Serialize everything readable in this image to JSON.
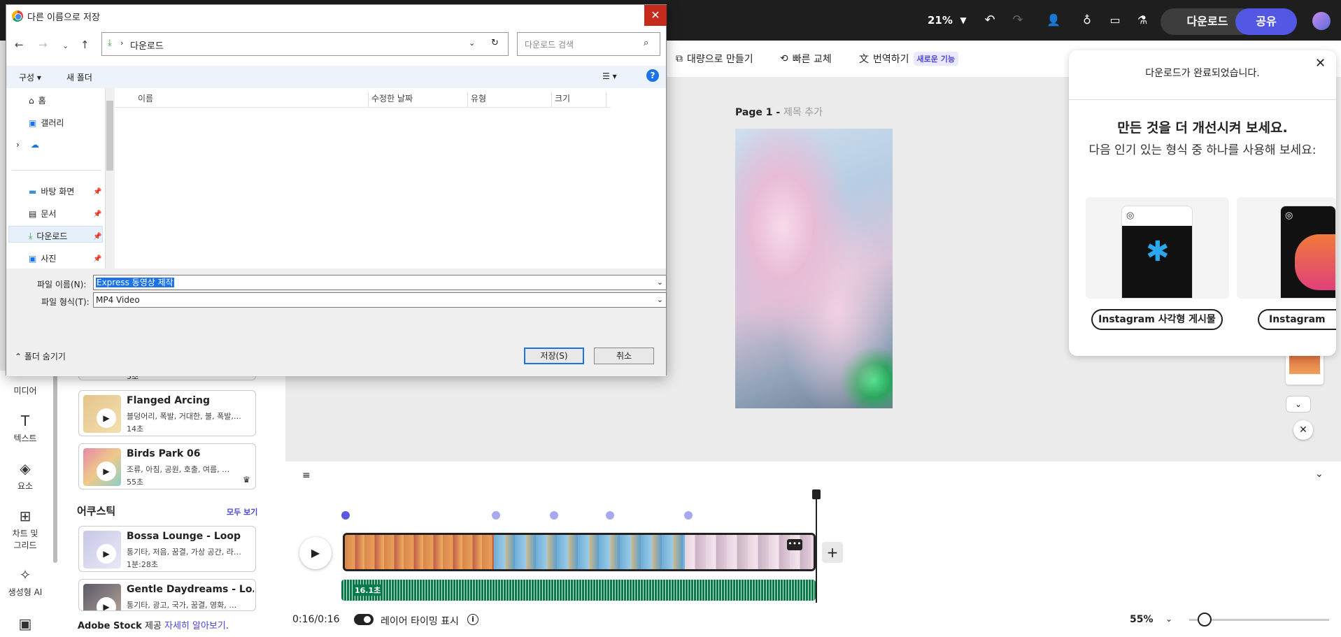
{
  "topbar": {
    "zoom": "21%",
    "download_label": "다운로드",
    "share_label": "공유"
  },
  "toolbar2": {
    "bulk_create": "대량으로 만들기",
    "quick_replace": "빠른 교체",
    "translate": "번역하기",
    "new_badge": "새로운 기능"
  },
  "canvas": {
    "page_label": "Page 1 -",
    "page_title_placeholder": "제목 추가"
  },
  "left_rail": [
    "미디어",
    "텍스트",
    "요소",
    "차트 및 그리드",
    "생성형 AI"
  ],
  "left_panel": {
    "partial_duration": "3초",
    "cards": [
      {
        "title": "Flanged Arcing",
        "desc": "블덩어리, 폭발, 거대한, 불, 폭발,…",
        "duration": "14초"
      },
      {
        "title": "Birds Park 06",
        "desc": "조류, 아침, 공원, 호출, 여름, …",
        "duration": "55초"
      }
    ],
    "section_title": "어쿠스틱",
    "see_all": "모두 보기",
    "acoustic_cards": [
      {
        "title": "Bossa Lounge - Loop",
        "desc": "통기타, 저음, 꿈결, 가상 공간, 라…",
        "duration": "1분:28초"
      },
      {
        "title": "Gentle Daydreams - Lo…",
        "desc": "통기타, 광고, 국가, 꿈결, 영화, …",
        "duration": ""
      }
    ],
    "stock_prefix": "Adobe Stock",
    "stock_mid": " 제공 ",
    "stock_link": "자세히 알아보기",
    "stock_suffix": "."
  },
  "timeline": {
    "audio_label": "16.1초",
    "time": "0:16/0:16",
    "layer_timing": "레이어 타이밍 표시",
    "zoom_pct": "55%"
  },
  "right_panel": {
    "done_msg": "다운로드가 완료되었습니다.",
    "title": "만든 것을 더 개선시켜 보세요.",
    "subtitle": "다음 인기 있는 형식 중 하나를 사용해 보세요:",
    "pill1": "Instagram 사각형 게시물",
    "pill2": "Instagram"
  },
  "dialog": {
    "title": "다른 이름으로 저장",
    "path": "다운로드",
    "search_placeholder": "다운로드 검색",
    "organize": "구성",
    "new_folder": "새 폴더",
    "nav": [
      "홈",
      "갤러리",
      "바탕 화면",
      "문서",
      "다운로드",
      "사진"
    ],
    "columns": [
      "이름",
      "수정한 날짜",
      "유형",
      "크기"
    ],
    "filename_label": "파일 이름(N):",
    "filename_value": "Express 동영상 제작",
    "filetype_label": "파일 형식(T):",
    "filetype_value": "MP4 Video",
    "hide_folders": "폴더 숨기기",
    "save": "저장(S)",
    "cancel": "취소"
  }
}
